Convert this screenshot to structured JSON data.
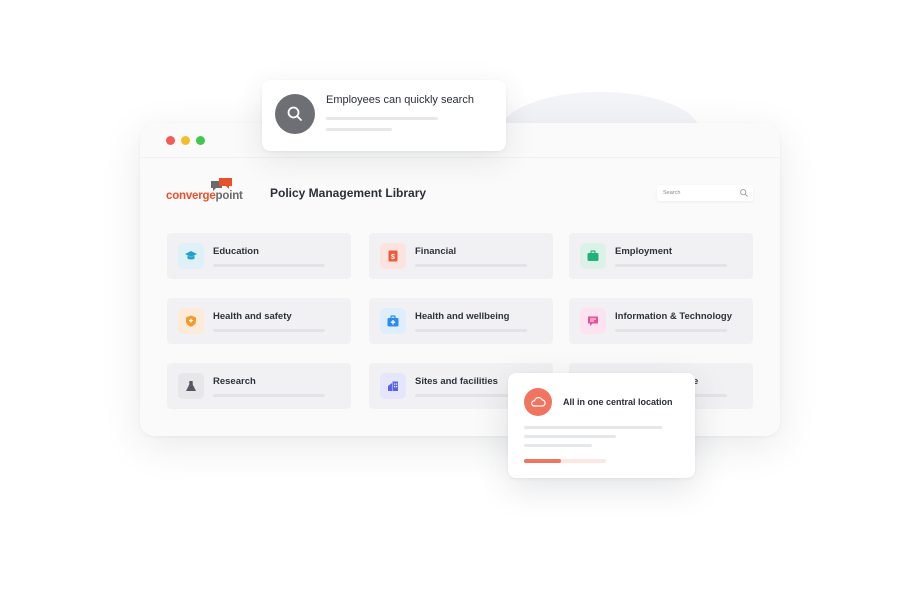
{
  "colors": {
    "accent_orange": "#f0745f",
    "logo_orange": "#e8502a",
    "logo_grey": "#6b6b6b",
    "dot_red": "#f25c54",
    "dot_yellow": "#f5bd2c",
    "dot_green": "#3ec84e"
  },
  "logo": {
    "part1": "converge",
    "part2": "point"
  },
  "header": {
    "title": "Policy Management Library"
  },
  "search": {
    "placeholder": "Search",
    "icon": "search-icon"
  },
  "categories": [
    {
      "label": "Education",
      "icon": "graduation-cap-icon",
      "tile_bg": "#dff0f7",
      "icon_color": "#1fa4c9"
    },
    {
      "label": "Financial",
      "icon": "dollar-bill-icon",
      "tile_bg": "#fbe4df",
      "icon_color": "#ef5b3a"
    },
    {
      "label": "Employment",
      "icon": "briefcase-icon",
      "tile_bg": "#dcf2e9",
      "icon_color": "#22b07d"
    },
    {
      "label": "Health and safety",
      "icon": "shield-icon",
      "tile_bg": "#fcebd9",
      "icon_color": "#f39a2c"
    },
    {
      "label": "Health and wellbeing",
      "icon": "medical-kit-icon",
      "tile_bg": "#dfeefc",
      "icon_color": "#2b8cf0"
    },
    {
      "label": "Information & Technology",
      "icon": "chat-icon",
      "tile_bg": "#fbe3ef",
      "icon_color": "#e8509b"
    },
    {
      "label": "Research",
      "icon": "flask-icon",
      "tile_bg": "#e7e7ea",
      "icon_color": "#555860"
    },
    {
      "label": "Sites and facilities",
      "icon": "building-icon",
      "tile_bg": "#e5e6fb",
      "icon_color": "#5b63e6"
    },
    {
      "label": "e",
      "icon": "",
      "tile_bg": "#eceef0",
      "icon_color": "#8a8d94"
    }
  ],
  "popup_search": {
    "title": "Employees can quickly search",
    "icon": "search-icon"
  },
  "popup_location": {
    "title": "All in one central location",
    "icon": "cloud-icon",
    "progress": 0.45
  }
}
